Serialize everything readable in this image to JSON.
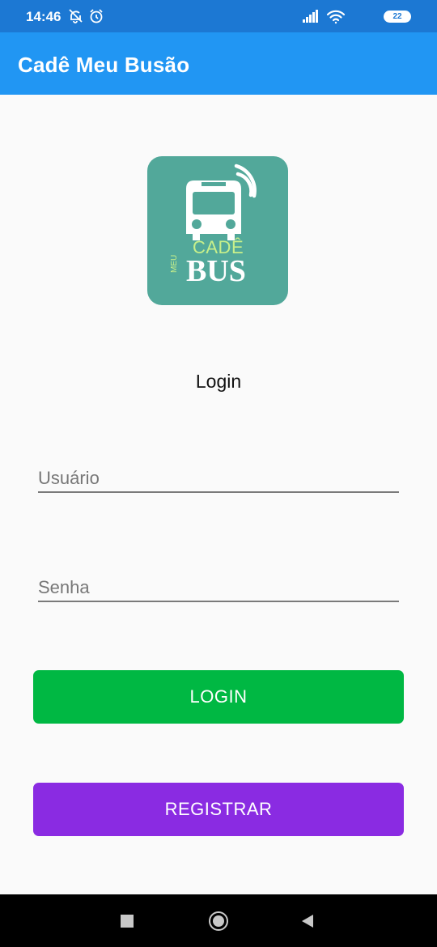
{
  "status_bar": {
    "time": "14:46",
    "battery": "22",
    "icons": [
      "alarm-off-icon",
      "alarm-clock-icon",
      "signal-icon",
      "wifi-icon",
      "battery-icon"
    ]
  },
  "app_bar": {
    "title": "Cadê Meu Busão",
    "color": "#2196f3"
  },
  "logo": {
    "background": "#52a89a",
    "text_cade": "CADÊ",
    "text_meu": "MEU",
    "text_bus": "BUS"
  },
  "login_form": {
    "heading": "Login",
    "username_placeholder": "Usuário",
    "password_placeholder": "Senha",
    "login_button": "LOGIN",
    "register_button": "REGISTRAR",
    "login_color": "#00b843",
    "register_color": "#8a2be2"
  },
  "nav_bar": {
    "icons": [
      "recents-icon",
      "home-icon",
      "back-icon"
    ]
  }
}
